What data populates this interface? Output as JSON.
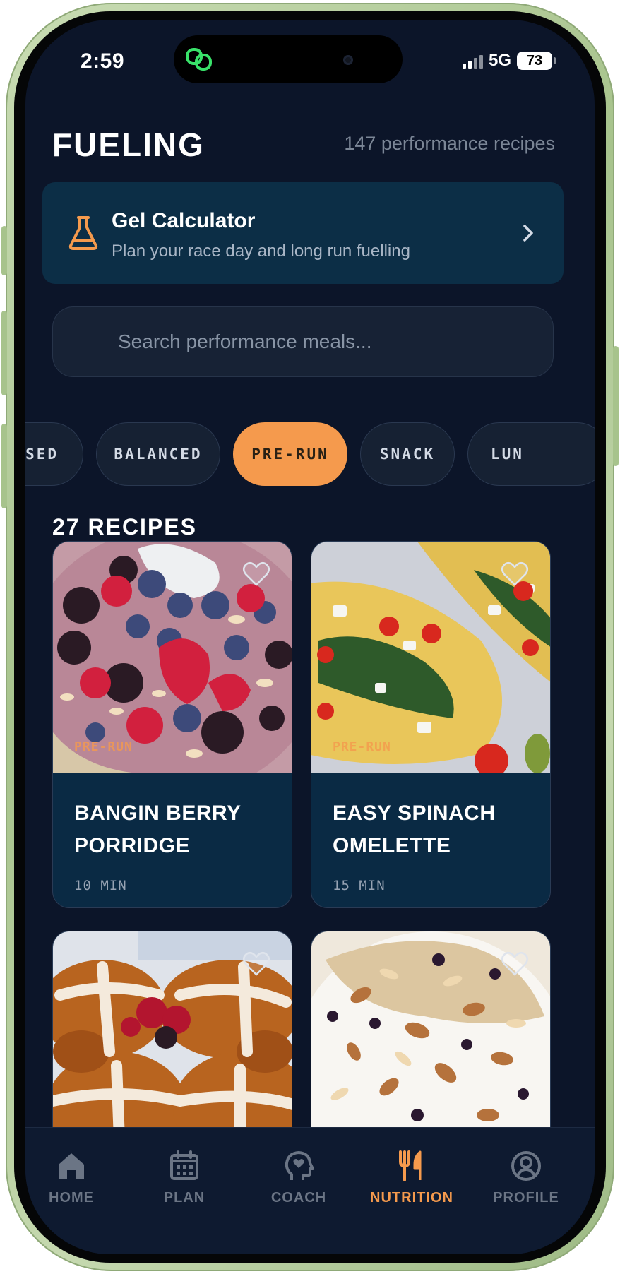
{
  "status_bar": {
    "time": "2:59",
    "network": "5G",
    "battery": "73"
  },
  "header": {
    "title": "FUELING",
    "recipe_total": "147 performance recipes"
  },
  "gel_calculator": {
    "title": "Gel Calculator",
    "subtitle": "Plan your race day and long run fuelling",
    "icon": "flask-icon"
  },
  "search": {
    "placeholder": "Search performance meals..."
  },
  "filters": {
    "chips": [
      "ASED",
      "BALANCED",
      "PRE-RUN",
      "SNACK",
      "LUN"
    ],
    "selected": "PRE-RUN"
  },
  "results": {
    "count_label": "27 RECIPES"
  },
  "recipes": [
    {
      "title_line1": "BANGIN BERRY",
      "title_line2": "PORRIDGE",
      "time": "10 MIN",
      "tag": "PRE-RUN",
      "favorited": false
    },
    {
      "title_line1": "EASY SPINACH",
      "title_line2": "OMELETTE",
      "time": "15 MIN",
      "tag": "PRE-RUN",
      "favorited": false
    },
    {
      "title_line1": "",
      "title_line2": "",
      "time": "",
      "tag": "",
      "favorited": false
    },
    {
      "title_line1": "",
      "title_line2": "",
      "time": "",
      "tag": "",
      "favorited": false
    }
  ],
  "bottom_nav": {
    "items": [
      {
        "label": "HOME",
        "icon": "home-icon"
      },
      {
        "label": "PLAN",
        "icon": "calendar-icon"
      },
      {
        "label": "COACH",
        "icon": "coach-head-icon"
      },
      {
        "label": "NUTRITION",
        "icon": "fork-knife-icon"
      },
      {
        "label": "PROFILE",
        "icon": "profile-icon"
      }
    ],
    "active": "NUTRITION"
  },
  "colors": {
    "background": "#0c1529",
    "accent": "#f59a4d",
    "card": "#0a2a44",
    "frame": "#a7c38c"
  }
}
